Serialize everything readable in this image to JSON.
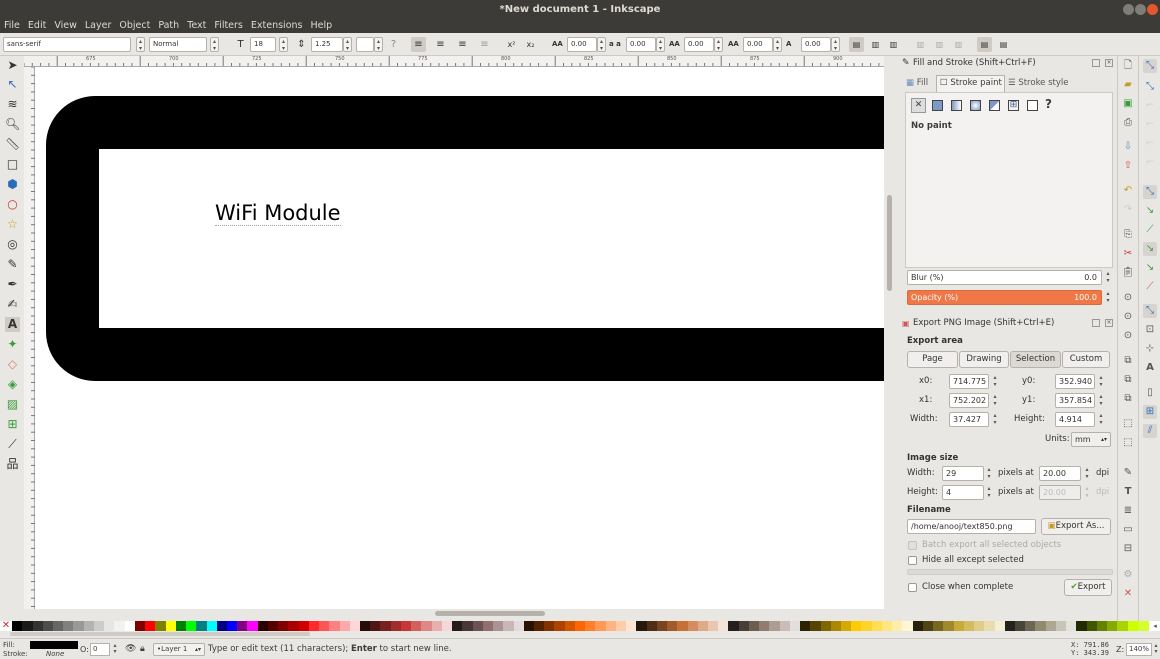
{
  "window": {
    "title": "*New document 1 - Inkscape"
  },
  "menu": [
    "File",
    "Edit",
    "View",
    "Layer",
    "Object",
    "Path",
    "Text",
    "Filters",
    "Extensions",
    "Help"
  ],
  "text_toolbar": {
    "font_family": "sans-serif",
    "font_style": "Normal",
    "font_size": "18",
    "line_spacing": "1.25",
    "kerning": "0.00",
    "word_spacing": "0.00",
    "letter_spacing": "0.00",
    "vkern": "0.00",
    "hkern": "0.00",
    "rotation": "0.00"
  },
  "ruler": {
    "ticks": [
      "675",
      "700",
      "725",
      "750",
      "775",
      "800",
      "825",
      "850",
      "875",
      "900"
    ]
  },
  "canvas": {
    "text": "WiFi Module"
  },
  "fill_stroke": {
    "title": "Fill and Stroke (Shift+Ctrl+F)",
    "tab_fill": "Fill",
    "tab_stroke_paint": "Stroke paint",
    "tab_stroke_style": "Stroke style",
    "paint_status": "No paint",
    "blur_label": "Blur (%)",
    "blur_value": "0.0",
    "opacity_label": "Opacity (%)",
    "opacity_value": "100.0",
    "opacity_color": "#f07746"
  },
  "export": {
    "title": "Export PNG Image (Shift+Ctrl+E)",
    "area_heading": "Export area",
    "btn_page": "Page",
    "btn_drawing": "Drawing",
    "btn_selection": "Selection",
    "btn_custom": "Custom",
    "x0_label": "x0:",
    "x0": "714.775",
    "y0_label": "y0:",
    "y0": "352.940",
    "x1_label": "x1:",
    "x1": "752.202",
    "y1_label": "y1:",
    "y1": "357.854",
    "width_label": "Width:",
    "width": "37.427",
    "height_label": "Height:",
    "height": "4.914",
    "units_label": "Units:",
    "units": "mm",
    "image_size_heading": "Image size",
    "img_width_label": "Width:",
    "img_width": "29",
    "img_height_label": "Height:",
    "img_height": "4",
    "pixels_at": "pixels at",
    "dpi": "20.00",
    "dpi_disabled": "20.00",
    "dpi_unit": "dpi",
    "filename_heading": "Filename",
    "filename": "/home/anooj/text850.png",
    "export_as": "Export As...",
    "batch_label": "Batch export all selected objects",
    "hide_label": "Hide all except selected",
    "close_label": "Close when complete",
    "export_btn": "Export"
  },
  "status": {
    "fill_label": "Fill:",
    "stroke_label": "Stroke:",
    "stroke_value": "None",
    "opacity_label": "O:",
    "opacity_value": "0",
    "layer": "•Layer 1",
    "message_pre": "Type or edit text (11 characters); ",
    "message_bold": "Enter",
    "message_post": " to start new line.",
    "x": "X:  791.86",
    "y": "Y:  343.39",
    "zoom_label": "Z:",
    "zoom": "140%"
  },
  "palette_colors": [
    "#000000",
    "#1a1a1a",
    "#333333",
    "#4d4d4d",
    "#666666",
    "#808080",
    "#999999",
    "#b3b3b3",
    "#cccccc",
    "#e6e6e6",
    "#f2f2f2",
    "#ffffff",
    "#800000",
    "#ff0000",
    "#808000",
    "#ffff00",
    "#008000",
    "#00ff00",
    "#008080",
    "#00ffff",
    "#000080",
    "#0000ff",
    "#800080",
    "#ff00ff",
    "#2b0000",
    "#550000",
    "#800000",
    "#aa0000",
    "#d40000",
    "#ff2a2a",
    "#ff5555",
    "#ff8080",
    "#ffaaaa",
    "#ffd5d5",
    "#280b0b",
    "#501616",
    "#782121",
    "#a02c2c",
    "#c83737",
    "#d35f5f",
    "#de8787",
    "#e9afaf",
    "#f4d7d7",
    "#241c1c",
    "#483737",
    "#6c5353",
    "#916f6f",
    "#ac9393",
    "#c8b7b7",
    "#e3dbdb",
    "#2b1100",
    "#552200",
    "#803300",
    "#aa4400",
    "#d45500",
    "#ff6600",
    "#ff7f2a",
    "#ff9955",
    "#ffb380",
    "#ffccaa",
    "#ffe6d5",
    "#28170b",
    "#502d16",
    "#784421",
    "#a05a2c",
    "#c87137",
    "#d38d5f",
    "#deaa87",
    "#e9c6af",
    "#f4e3d7",
    "#241f1c",
    "#483e37",
    "#6c5d53",
    "#917c6f",
    "#ac9d93",
    "#c8beb7",
    "#e3dedb",
    "#2b2200",
    "#554400",
    "#806600",
    "#aa8800",
    "#d4aa00",
    "#ffcc00",
    "#ffd42a",
    "#ffdd55",
    "#ffe680",
    "#ffeeaa",
    "#fff6d5",
    "#28220b",
    "#504416",
    "#786721",
    "#a0892c",
    "#c8ab37",
    "#d3bc5f",
    "#decd87",
    "#e9ddaf",
    "#f4eed7",
    "#24221c",
    "#484537",
    "#6c6753",
    "#918a6f",
    "#aca793",
    "#c8c4b7",
    "#e3e2db",
    "#222b00",
    "#445500",
    "#668000",
    "#88aa00",
    "#aad400",
    "#ccff00",
    "#d4ff2a"
  ]
}
